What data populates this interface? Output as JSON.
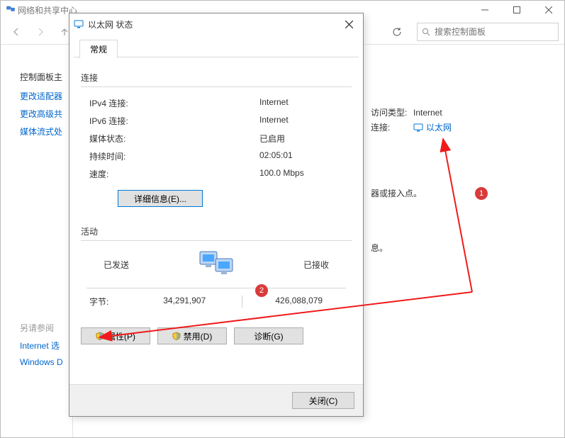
{
  "parentWindow": {
    "title": "网络和共享中心",
    "search_placeholder": "搜索控制面板",
    "sidebar": {
      "home": "控制面板主",
      "adapter": "更改适配器",
      "advanced": "更改高级共",
      "streaming": "媒体流式处",
      "seealso": "另请参阅",
      "inet_opts": "Internet 选",
      "windows": "Windows D"
    },
    "content": {
      "access_type_label": "访问类型:",
      "access_type_value": "Internet",
      "connections_label": "连接:",
      "connection_link": "以太网",
      "other1": "器或接入点。",
      "other2": "息。"
    }
  },
  "dialog": {
    "title": "以太网 状态",
    "tab_general": "常规",
    "section_connection": "连接",
    "rows": {
      "ipv4_label": "IPv4 连接:",
      "ipv4_value": "Internet",
      "ipv6_label": "IPv6 连接:",
      "ipv6_value": "Internet",
      "media_label": "媒体状态:",
      "media_value": "已启用",
      "duration_label": "持续时间:",
      "duration_value": "02:05:01",
      "speed_label": "速度:",
      "speed_value": "100.0 Mbps"
    },
    "details_btn": "详细信息(E)...",
    "section_activity": "活动",
    "activity": {
      "sent_label": "已发送",
      "recv_label": "已接收",
      "bytes_label": "字节:",
      "sent_value": "34,291,907",
      "recv_value": "426,088,079"
    },
    "buttons": {
      "properties": "属性(P)",
      "disable": "禁用(D)",
      "diagnose": "诊断(G)",
      "close": "关闭(C)"
    }
  },
  "annotations": {
    "n1": "1",
    "n2": "2"
  }
}
